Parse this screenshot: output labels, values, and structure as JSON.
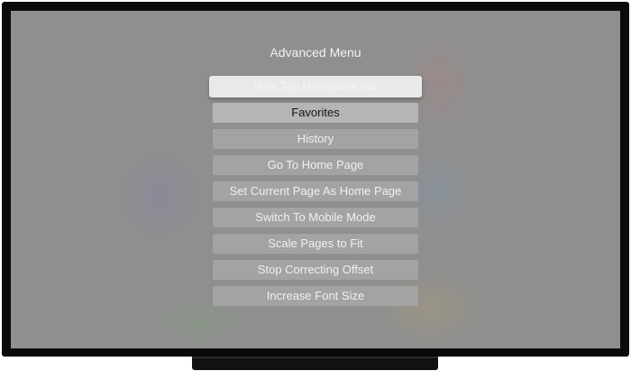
{
  "menu": {
    "title": "Advanced Menu",
    "items": [
      {
        "label": "Hide Top Navigation bar",
        "state": "focused"
      },
      {
        "label": "Favorites",
        "state": "highlight"
      },
      {
        "label": "History",
        "state": "normal"
      },
      {
        "label": "Go To Home Page",
        "state": "normal"
      },
      {
        "label": "Set Current Page As Home Page",
        "state": "normal"
      },
      {
        "label": "Switch To Mobile Mode",
        "state": "normal"
      },
      {
        "label": "Scale Pages to Fit",
        "state": "normal"
      },
      {
        "label": "Stop Correcting Offset",
        "state": "normal"
      },
      {
        "label": "Increase Font Size",
        "state": "normal"
      }
    ]
  },
  "colors": {
    "screen_background": "#8f8f8f",
    "focused_item": "#e9e9e9",
    "item_background": "#a3a3a3",
    "bezel": "#0a0a0a"
  }
}
